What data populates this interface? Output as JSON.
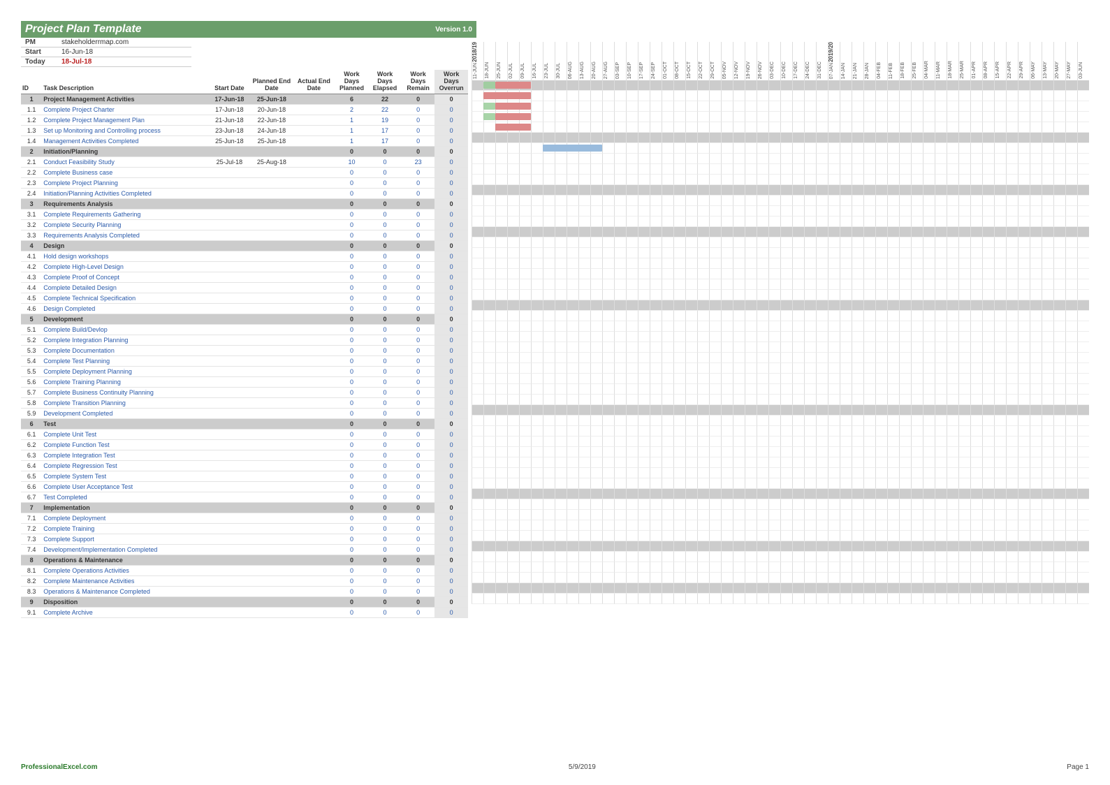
{
  "title": "Project Plan Template",
  "version": "Version 1.0",
  "meta": {
    "pm_label": "PM",
    "pm_value": "stakeholderrmap.com",
    "start_label": "Start",
    "start_value": "16-Jun-18",
    "today_label": "Today",
    "today_value": "18-Jul-18"
  },
  "columns": {
    "id": "ID",
    "task": "Task Description",
    "start": "Start Date",
    "planned": "Planned End Date",
    "actual": "Actual End Date",
    "wdp": "Work Days Planned",
    "wde": "Work Days Elapsed",
    "wdr": "Work Days Remain",
    "wdo": "Work Days Overrun"
  },
  "timeline": {
    "years": [
      {
        "label": "2018/19",
        "at": 0
      },
      {
        "label": "2019/20",
        "at": 30
      }
    ],
    "weeks": [
      "11-JUN",
      "18-JUN",
      "25-JUN",
      "02-JUL",
      "09-JUL",
      "16-JUL",
      "23-JUL",
      "30-JUL",
      "06-AUG",
      "13-AUG",
      "20-AUG",
      "27-AUG",
      "03-SEP",
      "10-SEP",
      "17-SEP",
      "24-SEP",
      "01-OCT",
      "08-OCT",
      "15-OCT",
      "22-OCT",
      "29-OCT",
      "05-NOV",
      "12-NOV",
      "19-NOV",
      "26-NOV",
      "03-DEC",
      "10-DEC",
      "17-DEC",
      "24-DEC",
      "31-DEC",
      "07-JAN",
      "14-JAN",
      "21-JAN",
      "28-JAN",
      "04-FEB",
      "11-FEB",
      "18-FEB",
      "25-FEB",
      "04-MAR",
      "11-MAR",
      "18-MAR",
      "25-MAR",
      "01-APR",
      "08-APR",
      "15-APR",
      "22-APR",
      "29-APR",
      "06-MAY",
      "13-MAY",
      "20-MAY",
      "27-MAY",
      "03-JUN"
    ]
  },
  "rows": [
    {
      "id": "1",
      "task": "Project Management Activities",
      "start": "17-Jun-18",
      "planned": "25-Jun-18",
      "actual": "",
      "wdp": "6",
      "wde": "22",
      "wdr": "0",
      "wdo": "0",
      "group": true,
      "bars": [
        {
          "type": "green",
          "from": 1,
          "span": 2
        },
        {
          "type": "red",
          "from": 2,
          "span": 3
        }
      ]
    },
    {
      "id": "1.1",
      "task": "Complete Project Charter",
      "start": "17-Jun-18",
      "planned": "20-Jun-18",
      "actual": "",
      "wdp": "2",
      "wde": "22",
      "wdr": "0",
      "wdo": "0",
      "bars": [
        {
          "type": "green",
          "from": 1,
          "span": 1
        },
        {
          "type": "red",
          "from": 1,
          "span": 4
        }
      ]
    },
    {
      "id": "1.2",
      "task": "Complete Project Management Plan",
      "start": "21-Jun-18",
      "planned": "22-Jun-18",
      "actual": "",
      "wdp": "1",
      "wde": "19",
      "wdr": "0",
      "wdo": "0",
      "bars": [
        {
          "type": "green",
          "from": 1,
          "span": 1
        },
        {
          "type": "red",
          "from": 2,
          "span": 3
        }
      ]
    },
    {
      "id": "1.3",
      "task": "Set up Monitoring and Controlling process",
      "start": "23-Jun-18",
      "planned": "24-Jun-18",
      "actual": "",
      "wdp": "1",
      "wde": "17",
      "wdr": "0",
      "wdo": "0",
      "bars": [
        {
          "type": "green",
          "from": 1,
          "span": 1
        },
        {
          "type": "red",
          "from": 2,
          "span": 3
        }
      ]
    },
    {
      "id": "1.4",
      "task": "Management Activities Completed",
      "start": "25-Jun-18",
      "planned": "25-Jun-18",
      "actual": "",
      "wdp": "1",
      "wde": "17",
      "wdr": "0",
      "wdo": "0",
      "bars": [
        {
          "type": "green",
          "from": 2,
          "span": 1
        },
        {
          "type": "red",
          "from": 2,
          "span": 3
        }
      ]
    },
    {
      "id": "2",
      "task": "Initiation/Planning",
      "start": "",
      "planned": "",
      "actual": "",
      "wdp": "0",
      "wde": "0",
      "wdr": "0",
      "wdo": "0",
      "group": true
    },
    {
      "id": "2.1",
      "task": "Conduct Feasibility Study",
      "start": "25-Jul-18",
      "planned": "25-Aug-18",
      "actual": "",
      "wdp": "10",
      "wde": "0",
      "wdr": "23",
      "wdo": "0",
      "bars": [
        {
          "type": "blue",
          "from": 6,
          "span": 5
        }
      ]
    },
    {
      "id": "2.2",
      "task": "Complete Business case",
      "start": "",
      "planned": "",
      "actual": "",
      "wdp": "0",
      "wde": "0",
      "wdr": "0",
      "wdo": "0"
    },
    {
      "id": "2.3",
      "task": "Complete Project Planning",
      "start": "",
      "planned": "",
      "actual": "",
      "wdp": "0",
      "wde": "0",
      "wdr": "0",
      "wdo": "0"
    },
    {
      "id": "2.4",
      "task": "Initiation/Planning Activities Completed",
      "start": "",
      "planned": "",
      "actual": "",
      "wdp": "0",
      "wde": "0",
      "wdr": "0",
      "wdo": "0"
    },
    {
      "id": "3",
      "task": "Requirements Analysis",
      "start": "",
      "planned": "",
      "actual": "",
      "wdp": "0",
      "wde": "0",
      "wdr": "0",
      "wdo": "0",
      "group": true
    },
    {
      "id": "3.1",
      "task": "Complete Requirements Gathering",
      "start": "",
      "planned": "",
      "actual": "",
      "wdp": "0",
      "wde": "0",
      "wdr": "0",
      "wdo": "0"
    },
    {
      "id": "3.2",
      "task": "Complete Security Planning",
      "start": "",
      "planned": "",
      "actual": "",
      "wdp": "0",
      "wde": "0",
      "wdr": "0",
      "wdo": "0"
    },
    {
      "id": "3.3",
      "task": "Requirements Analysis Completed",
      "start": "",
      "planned": "",
      "actual": "",
      "wdp": "0",
      "wde": "0",
      "wdr": "0",
      "wdo": "0"
    },
    {
      "id": "4",
      "task": "Design",
      "start": "",
      "planned": "",
      "actual": "",
      "wdp": "0",
      "wde": "0",
      "wdr": "0",
      "wdo": "0",
      "group": true
    },
    {
      "id": "4.1",
      "task": "Hold design workshops",
      "start": "",
      "planned": "",
      "actual": "",
      "wdp": "0",
      "wde": "0",
      "wdr": "0",
      "wdo": "0"
    },
    {
      "id": "4.2",
      "task": "Complete High-Level Design",
      "start": "",
      "planned": "",
      "actual": "",
      "wdp": "0",
      "wde": "0",
      "wdr": "0",
      "wdo": "0"
    },
    {
      "id": "4.3",
      "task": "Complete Proof of Concept",
      "start": "",
      "planned": "",
      "actual": "",
      "wdp": "0",
      "wde": "0",
      "wdr": "0",
      "wdo": "0"
    },
    {
      "id": "4.4",
      "task": "Complete Detailed Design",
      "start": "",
      "planned": "",
      "actual": "",
      "wdp": "0",
      "wde": "0",
      "wdr": "0",
      "wdo": "0"
    },
    {
      "id": "4.5",
      "task": "Complete Technical Specification",
      "start": "",
      "planned": "",
      "actual": "",
      "wdp": "0",
      "wde": "0",
      "wdr": "0",
      "wdo": "0"
    },
    {
      "id": "4.6",
      "task": "Design Completed",
      "start": "",
      "planned": "",
      "actual": "",
      "wdp": "0",
      "wde": "0",
      "wdr": "0",
      "wdo": "0"
    },
    {
      "id": "5",
      "task": "Development",
      "start": "",
      "planned": "",
      "actual": "",
      "wdp": "0",
      "wde": "0",
      "wdr": "0",
      "wdo": "0",
      "group": true
    },
    {
      "id": "5.1",
      "task": "Complete Build/Devlop",
      "start": "",
      "planned": "",
      "actual": "",
      "wdp": "0",
      "wde": "0",
      "wdr": "0",
      "wdo": "0"
    },
    {
      "id": "5.2",
      "task": "Complete Integration Planning",
      "start": "",
      "planned": "",
      "actual": "",
      "wdp": "0",
      "wde": "0",
      "wdr": "0",
      "wdo": "0"
    },
    {
      "id": "5.3",
      "task": "Complete Documentation",
      "start": "",
      "planned": "",
      "actual": "",
      "wdp": "0",
      "wde": "0",
      "wdr": "0",
      "wdo": "0"
    },
    {
      "id": "5.4",
      "task": "Complete Test Planning",
      "start": "",
      "planned": "",
      "actual": "",
      "wdp": "0",
      "wde": "0",
      "wdr": "0",
      "wdo": "0"
    },
    {
      "id": "5.5",
      "task": "Complete Deployment Planning",
      "start": "",
      "planned": "",
      "actual": "",
      "wdp": "0",
      "wde": "0",
      "wdr": "0",
      "wdo": "0"
    },
    {
      "id": "5.6",
      "task": "Complete Training Planning",
      "start": "",
      "planned": "",
      "actual": "",
      "wdp": "0",
      "wde": "0",
      "wdr": "0",
      "wdo": "0"
    },
    {
      "id": "5.7",
      "task": "Complete Business Continuity Planning",
      "start": "",
      "planned": "",
      "actual": "",
      "wdp": "0",
      "wde": "0",
      "wdr": "0",
      "wdo": "0"
    },
    {
      "id": "5.8",
      "task": "Complete Transition Planning",
      "start": "",
      "planned": "",
      "actual": "",
      "wdp": "0",
      "wde": "0",
      "wdr": "0",
      "wdo": "0"
    },
    {
      "id": "5.9",
      "task": "Development Completed",
      "start": "",
      "planned": "",
      "actual": "",
      "wdp": "0",
      "wde": "0",
      "wdr": "0",
      "wdo": "0"
    },
    {
      "id": "6",
      "task": "Test",
      "start": "",
      "planned": "",
      "actual": "",
      "wdp": "0",
      "wde": "0",
      "wdr": "0",
      "wdo": "0",
      "group": true
    },
    {
      "id": "6.1",
      "task": "Complete Unit Test",
      "start": "",
      "planned": "",
      "actual": "",
      "wdp": "0",
      "wde": "0",
      "wdr": "0",
      "wdo": "0"
    },
    {
      "id": "6.2",
      "task": "Complete Function Test",
      "start": "",
      "planned": "",
      "actual": "",
      "wdp": "0",
      "wde": "0",
      "wdr": "0",
      "wdo": "0"
    },
    {
      "id": "6.3",
      "task": "Complete Integration Test",
      "start": "",
      "planned": "",
      "actual": "",
      "wdp": "0",
      "wde": "0",
      "wdr": "0",
      "wdo": "0"
    },
    {
      "id": "6.4",
      "task": "Complete Regression Test",
      "start": "",
      "planned": "",
      "actual": "",
      "wdp": "0",
      "wde": "0",
      "wdr": "0",
      "wdo": "0"
    },
    {
      "id": "6.5",
      "task": "Complete System Test",
      "start": "",
      "planned": "",
      "actual": "",
      "wdp": "0",
      "wde": "0",
      "wdr": "0",
      "wdo": "0"
    },
    {
      "id": "6.6",
      "task": "Complete User Acceptance Test",
      "start": "",
      "planned": "",
      "actual": "",
      "wdp": "0",
      "wde": "0",
      "wdr": "0",
      "wdo": "0"
    },
    {
      "id": "6.7",
      "task": "Test Completed",
      "start": "",
      "planned": "",
      "actual": "",
      "wdp": "0",
      "wde": "0",
      "wdr": "0",
      "wdo": "0"
    },
    {
      "id": "7",
      "task": "Implementation",
      "start": "",
      "planned": "",
      "actual": "",
      "wdp": "0",
      "wde": "0",
      "wdr": "0",
      "wdo": "0",
      "group": true
    },
    {
      "id": "7.1",
      "task": "Complete Deployment",
      "start": "",
      "planned": "",
      "actual": "",
      "wdp": "0",
      "wde": "0",
      "wdr": "0",
      "wdo": "0"
    },
    {
      "id": "7.2",
      "task": "Complete Training",
      "start": "",
      "planned": "",
      "actual": "",
      "wdp": "0",
      "wde": "0",
      "wdr": "0",
      "wdo": "0"
    },
    {
      "id": "7.3",
      "task": "Complete  Support",
      "start": "",
      "planned": "",
      "actual": "",
      "wdp": "0",
      "wde": "0",
      "wdr": "0",
      "wdo": "0"
    },
    {
      "id": "7.4",
      "task": "Development/Implementation Completed",
      "start": "",
      "planned": "",
      "actual": "",
      "wdp": "0",
      "wde": "0",
      "wdr": "0",
      "wdo": "0"
    },
    {
      "id": "8",
      "task": "Operations & Maintenance",
      "start": "",
      "planned": "",
      "actual": "",
      "wdp": "0",
      "wde": "0",
      "wdr": "0",
      "wdo": "0",
      "group": true
    },
    {
      "id": "8.1",
      "task": "Complete Operations Activities",
      "start": "",
      "planned": "",
      "actual": "",
      "wdp": "0",
      "wde": "0",
      "wdr": "0",
      "wdo": "0"
    },
    {
      "id": "8.2",
      "task": "Complete Maintenance Activities",
      "start": "",
      "planned": "",
      "actual": "",
      "wdp": "0",
      "wde": "0",
      "wdr": "0",
      "wdo": "0"
    },
    {
      "id": "8.3",
      "task": "Operations & Maintenance Completed",
      "start": "",
      "planned": "",
      "actual": "",
      "wdp": "0",
      "wde": "0",
      "wdr": "0",
      "wdo": "0"
    },
    {
      "id": "9",
      "task": "Disposition",
      "start": "",
      "planned": "",
      "actual": "",
      "wdp": "0",
      "wde": "0",
      "wdr": "0",
      "wdo": "0",
      "group": true
    },
    {
      "id": "9.1",
      "task": "Complete Archive",
      "start": "",
      "planned": "",
      "actual": "",
      "wdp": "0",
      "wde": "0",
      "wdr": "0",
      "wdo": "0"
    }
  ],
  "footer": {
    "left": "ProfessionalExcel.com",
    "center": "5/9/2019",
    "right": "Page 1"
  },
  "chart_data": {
    "type": "gantt",
    "x_unit": "week",
    "x_start": "2018-06-11",
    "x_labels": [
      "11-JUN",
      "18-JUN",
      "25-JUN",
      "02-JUL",
      "09-JUL",
      "16-JUL",
      "23-JUL",
      "30-JUL",
      "06-AUG",
      "13-AUG",
      "20-AUG",
      "27-AUG",
      "03-SEP",
      "10-SEP",
      "17-SEP",
      "24-SEP",
      "01-OCT",
      "08-OCT",
      "15-OCT",
      "22-OCT",
      "29-OCT",
      "05-NOV",
      "12-NOV",
      "19-NOV",
      "26-NOV",
      "03-DEC",
      "10-DEC",
      "17-DEC",
      "24-DEC",
      "31-DEC",
      "07-JAN",
      "14-JAN",
      "21-JAN",
      "28-JAN",
      "04-FEB",
      "11-FEB",
      "18-FEB",
      "25-FEB",
      "04-MAR",
      "11-MAR",
      "18-MAR",
      "25-MAR",
      "01-APR",
      "08-APR",
      "15-APR",
      "22-APR",
      "29-APR",
      "06-MAY",
      "13-MAY",
      "20-MAY",
      "27-MAY",
      "03-JUN"
    ],
    "series": [
      {
        "task_id": "1",
        "name": "Project Management Activities",
        "bars": [
          {
            "color": "green",
            "start_week": 1,
            "span": 2
          },
          {
            "color": "red",
            "start_week": 2,
            "span": 3
          }
        ]
      },
      {
        "task_id": "1.1",
        "name": "Complete Project Charter",
        "bars": [
          {
            "color": "green",
            "start_week": 1,
            "span": 1
          },
          {
            "color": "red",
            "start_week": 1,
            "span": 4
          }
        ]
      },
      {
        "task_id": "1.2",
        "name": "Complete Project Management Plan",
        "bars": [
          {
            "color": "green",
            "start_week": 1,
            "span": 1
          },
          {
            "color": "red",
            "start_week": 2,
            "span": 3
          }
        ]
      },
      {
        "task_id": "1.3",
        "name": "Set up Monitoring and Controlling process",
        "bars": [
          {
            "color": "green",
            "start_week": 1,
            "span": 1
          },
          {
            "color": "red",
            "start_week": 2,
            "span": 3
          }
        ]
      },
      {
        "task_id": "1.4",
        "name": "Management Activities Completed",
        "bars": [
          {
            "color": "green",
            "start_week": 2,
            "span": 1
          },
          {
            "color": "red",
            "start_week": 2,
            "span": 3
          }
        ]
      },
      {
        "task_id": "2.1",
        "name": "Conduct Feasibility Study",
        "bars": [
          {
            "color": "blue",
            "start_week": 6,
            "span": 5
          }
        ]
      }
    ]
  }
}
